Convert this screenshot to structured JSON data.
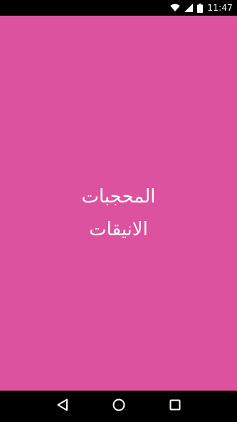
{
  "status_bar": {
    "time": "11:47",
    "icons": [
      "wifi-icon",
      "signal-icon",
      "battery-icon"
    ]
  },
  "splash": {
    "background_color": "#dc529e",
    "title_line_1": "المحجبات",
    "title_line_2": "الانيقات"
  },
  "nav_bar": {
    "buttons": [
      "back-icon",
      "home-icon",
      "recents-icon"
    ]
  }
}
